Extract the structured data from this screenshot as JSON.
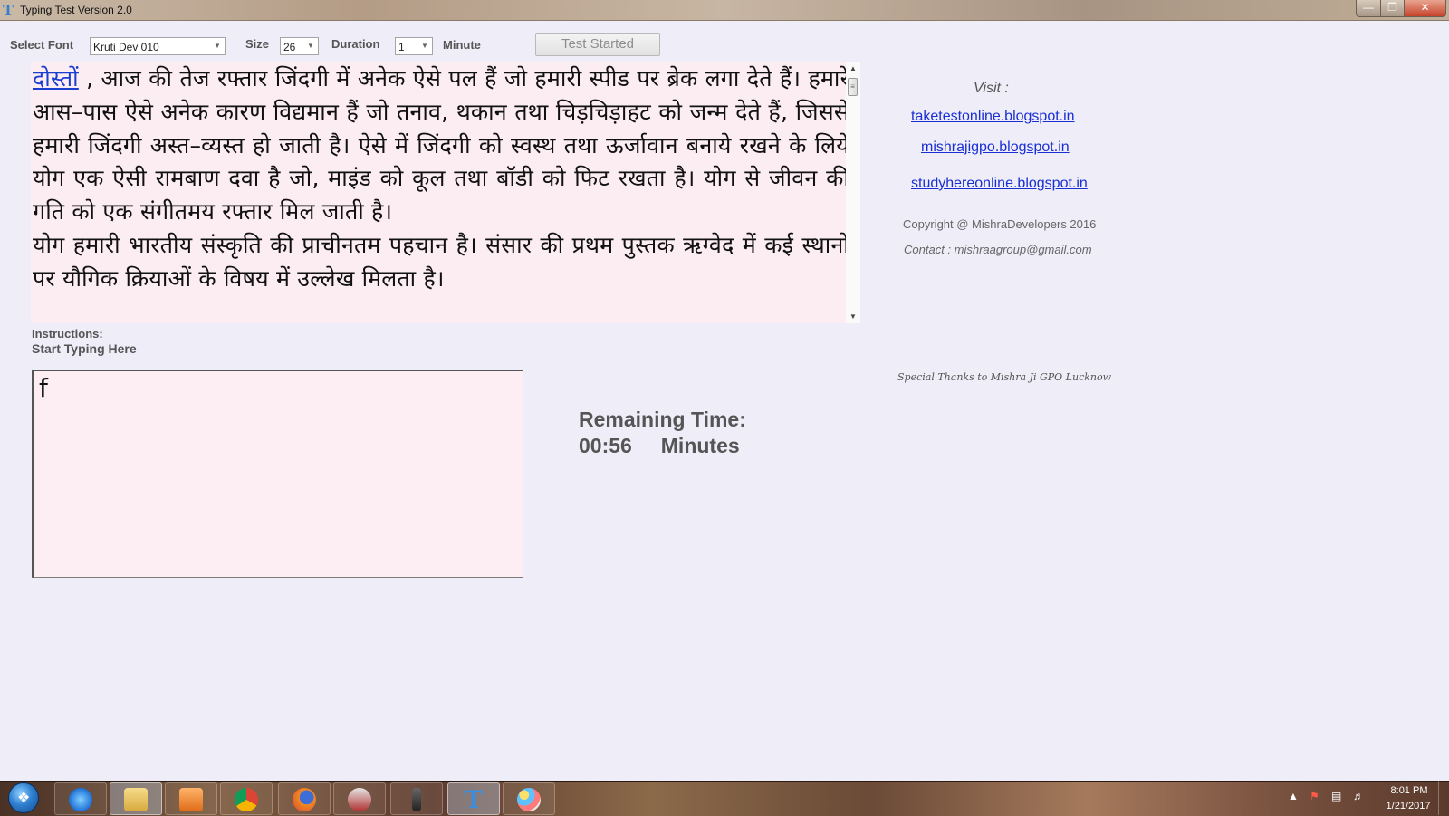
{
  "window": {
    "title": "Typing Test Version 2.0",
    "icon": "T"
  },
  "toolbar": {
    "font_label": "Select Font",
    "font_value": "Kruti Dev 010",
    "size_label": "Size",
    "size_value": "26",
    "duration_label": "Duration",
    "duration_value": "1",
    "minute_label": "Minute",
    "start_button": "Test Started"
  },
  "passage": {
    "first_word": "दोस्तों",
    "text": " , आज की तेज रफ्तार जिंदगी में अनेक ऐसे पल हैं जो हमारी स्पीड पर ब्रेक लगा देते हैं। हमारे आस–पास ऐसे अनेक कारण विद्यमान हैं जो तनाव, थकान तथा चिड़चिड़ाहट को जन्म देते हैं, जिससे हमारी जिंदगी अस्त–व्यस्त हो जाती है। ऐसे में जिंदगी को स्वस्थ तथा ऊर्जावान बनाये रखने के लिये योग एक ऐसी रामबाण दवा है जो, माइंड को कूल तथा बॉडी को फिट रखता है। योग से जीवन की गति को एक संगीतमय रफ्तार मिल जाती है।",
    "text2": "योग हमारी भारतीय संस्कृति की प्राचीनतम पहचान है। संसार की प्रथम पुस्तक ऋग्वेद में कई स्थानों पर यौगिक क्रियाओं के विषय में उल्लेख मिलता है।"
  },
  "instructions": {
    "label": "Instructions:",
    "prompt": "Start Typing Here"
  },
  "typing": {
    "value": "f"
  },
  "timer": {
    "label": "Remaining Time:",
    "value": "00:56     Minutes"
  },
  "side": {
    "visit": "Visit :",
    "links": [
      "taketestonline.blogspot.in",
      "mishrajigpo.blogspot.in",
      "studyhereonline.blogspot.in"
    ],
    "copyright": "Copyright @ MishraDevelopers 2016",
    "contact": "Contact : mishraagroup@gmail.com",
    "thanks": "Special Thanks to Mishra Ji GPO Lucknow"
  },
  "taskbar": {
    "icons": [
      "ie-icon",
      "explorer-icon",
      "media-player-icon",
      "chrome-icon",
      "firefox-icon",
      "tools-icon",
      "recorder-icon",
      "typing-test-icon",
      "paint-icon"
    ],
    "time": "8:01 PM",
    "date": "1/21/2017"
  }
}
